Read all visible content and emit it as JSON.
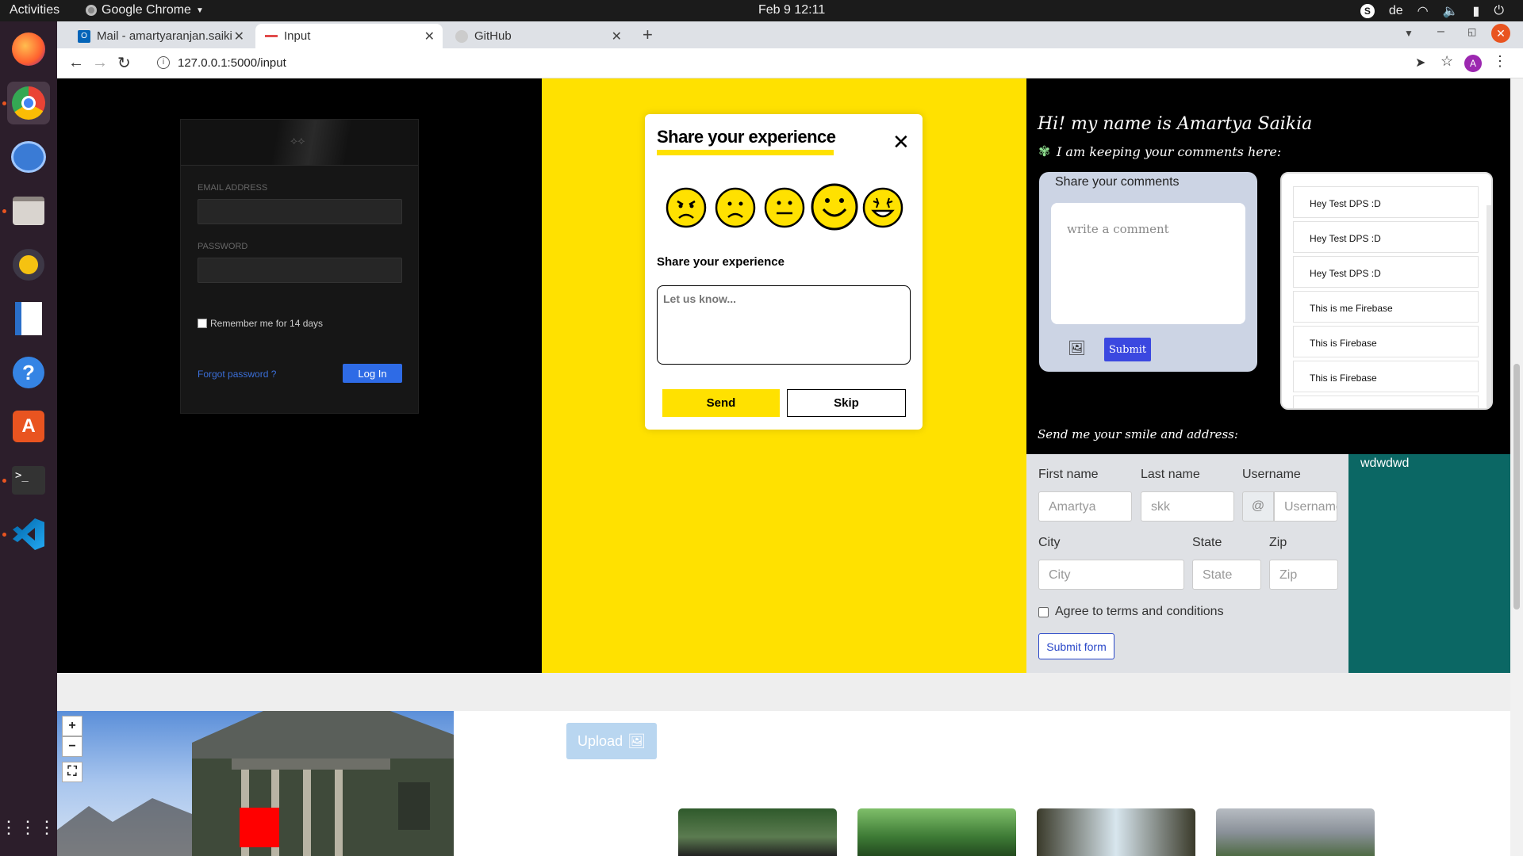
{
  "os": {
    "activities": "Activities",
    "app_name": "Google Chrome",
    "clock": "Feb 9  12:11",
    "lang": "de"
  },
  "browser": {
    "tabs": [
      {
        "label": "Mail - amartyaranjan.saiki"
      },
      {
        "label": "Input"
      },
      {
        "label": "GitHub"
      }
    ],
    "url": "127.0.0.1:5000/input",
    "profile_initial": "A"
  },
  "login": {
    "email_label": "EMAIL ADDRESS",
    "password_label": "PASSWORD",
    "remember": "Remember me for 14 days",
    "forgot": "Forgot password ?",
    "login_button": "Log In"
  },
  "feedback_modal": {
    "title": "Share your experience",
    "subtitle": "Share your experience",
    "placeholder": "Let us know...",
    "send": "Send",
    "skip": "Skip",
    "selected_emoji": 4
  },
  "profile": {
    "heading": "Hi! my name is Amartya Saikia",
    "subheading": "I am keeping your comments here:",
    "address_heading": "Send me your smile and address:"
  },
  "comments": {
    "title": "Share your comments",
    "placeholder": "write a comment",
    "submit": "Submit",
    "items": [
      "Hey Test DPS :D",
      "Hey Test DPS :D",
      "Hey Test DPS :D",
      "This is me Firebase",
      "This is Firebase",
      "This is Firebase"
    ]
  },
  "form": {
    "first_name_label": "First name",
    "first_name_value": "Amartya",
    "last_name_label": "Last name",
    "last_name_value": "skk",
    "username_label": "Username",
    "username_prefix": "@",
    "username_placeholder": "Username",
    "city_label": "City",
    "city_placeholder": "City",
    "state_label": "State",
    "state_placeholder": "State",
    "zip_label": "Zip",
    "zip_placeholder": "Zip",
    "agree": "Agree to terms and conditions",
    "submit": "Submit form"
  },
  "teal_box": {
    "text": "wdwdwd"
  },
  "gallery": {
    "upload": "Upload"
  },
  "colors": {
    "yellow": "#ffe100",
    "teal": "#0b6764",
    "submit_blue": "#3b48e0"
  }
}
